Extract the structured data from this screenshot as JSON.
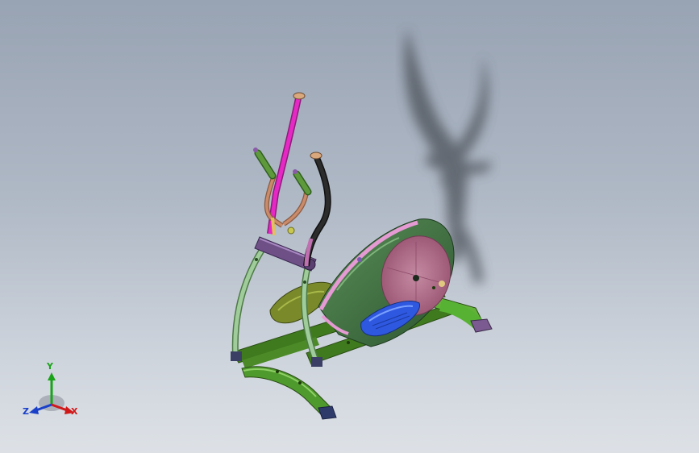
{
  "view": {
    "background_top": "#98a3b3",
    "background_bottom": "#dde1e6"
  },
  "model": {
    "colors": {
      "frame": "#3f7a1e",
      "frame_light": "#62a83a",
      "upright": "#9fcc9a",
      "handle_pink": "#e629c4",
      "handle_black": "#222222",
      "handle_copper": "#c98b6a",
      "flywheel_housing": "#3b6a3c",
      "flywheel_disk": "#b06b86",
      "trim_pink": "#e59ad4",
      "pedal": "#2f58e0",
      "cap_purple": "#6e4f86",
      "end_cap": "#d9a87c"
    }
  },
  "triad": {
    "x_label": "X",
    "y_label": "Y",
    "z_label": "Z",
    "x_color": "#d01818",
    "y_color": "#1aa31a",
    "z_color": "#1a3fc9"
  }
}
